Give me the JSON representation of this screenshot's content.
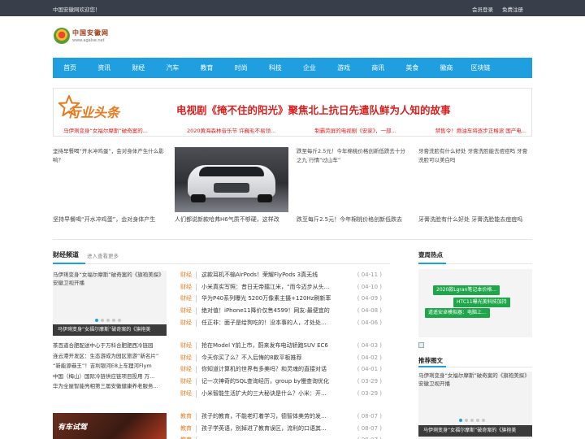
{
  "topbar": {
    "welcome": "中国安徽网欢迎您！",
    "login": "会员登录",
    "register": "免费注册"
  },
  "logo": {
    "name": "中国安徽网",
    "url": "www.agalse.net"
  },
  "nav": [
    "首页",
    "资讯",
    "财经",
    "汽车",
    "教育",
    "时尚",
    "科技",
    "企业",
    "游戏",
    "商讯",
    "美食",
    "徽商",
    "区块链"
  ],
  "banner": {
    "brand": "行业头条",
    "headline": "电视剧《掩不住的阳光》聚焦北上抗日先遣队鲜为人知的故事",
    "subs": [
      "马伊琍变身“女福尔摩斯”破奇案的...",
      "2020黄海森林音乐节 许巍毛不易领...",
      "制霸荧屏的电视剧《安家》，一部...",
      "禁售令！燃油车将逐步正格滚 国产电..."
    ]
  },
  "pictures": [
    {
      "alt": "坚持早餐喝“开水冲鸡蛋”，会对身体产生什么影响？",
      "caption": "坚持早餐喝“开水冲鸡蛋”，会对身体产生"
    },
    {
      "alt": "",
      "caption": "人们都说新款哈弗H6气质不够硬，这样改"
    },
    {
      "alt": "跌至每斤2.5元！今年棉桃价格创新低跌去十分之九 行情“过山车”",
      "caption": "跌至每斤2.5元！今年棉桃价格创新低跌去"
    },
    {
      "alt": "牙膏洗脸有什么好处 牙膏洗脸能去痘痘吗 牙膏洗脸可以美白吗",
      "caption": "牙膏洗脸有什么好处 牙膏洗脸能去痘痘吗"
    }
  ],
  "finance": {
    "title": "财经频道",
    "more": "进入查看更多",
    "slide_text": "马伊琍变身“女福尔摩斯”破奇案的《旗袍美探》安徽卫视开播",
    "slide_caption": "马伊琍变身“女福尔摩斯”破奇案的《旗袍美",
    "left_list": [
      "茶百道合肥配送中心于万科合肥肥西冷链园",
      "连云港开发区：生态游成为园区旅游“新名片”",
      "“新能源巷王”！吉利银河E8上车狸河Flym",
      "中国（梅山）国际冷链供应链项目投用 万...",
      "华为全屋智能亮相第三届安徽健康养老服务..."
    ],
    "thumb_text": "有车试驾",
    "news_top": [
      {
        "cat": "财经",
        "title": "这款耳机不输AirPods！荣耀FlyPods 3真无线",
        "date": "( 04-11 )"
      },
      {
        "cat": "财经",
        "title": "小米真实写照：昔日无帝擂江米，“而今迈步从头...",
        "date": "( 04-10 )"
      },
      {
        "cat": "财经",
        "title": "华为P40系列曝光 5200万像素主摄+120Hz刷新率",
        "date": "( 04-09 )"
      },
      {
        "cat": "财经",
        "title": "绝对值！iPhone11降价仅售4599！网友:最便宜的",
        "date": "( 04-08 )"
      },
      {
        "cat": "财经",
        "title": "任正非：面子是给狗吃的！没本事的人，才处处...",
        "date": "( 04-06 )"
      }
    ],
    "news_bottom": [
      {
        "cat": "财经",
        "title": "抢在Model Y前上市，蔚来发布电动轿跑SUV EC6",
        "date": "( 04-03 )"
      },
      {
        "cat": "财经",
        "title": "今天你买了么？不入后悔的8款平板推荐",
        "date": "( 04-02 )"
      },
      {
        "cat": "财经",
        "title": "你知道计算机的世界有多美吗？和灵魂的直接对话",
        "date": "( 04-01 )"
      },
      {
        "cat": "财经",
        "title": "记一次神奇的SQL查询经历，group by慢查询优化",
        "date": "( 03-29 )"
      },
      {
        "cat": "财经",
        "title": "小米智能生活扩大的三大秘诀是什么？小米：开...",
        "date": "( 03-29 )"
      }
    ],
    "news_third": [
      {
        "cat": "教育",
        "title": "孩子的教育，不能老盯着学习，德智体美劳的发...",
        "date": "( 08-07 )"
      },
      {
        "cat": "教育",
        "title": "孩子学英语，别掉进了教育误区，流利的口语其...",
        "date": "( 08-07 )"
      },
      {
        "cat": "教育",
        "title": "",
        "date": "( 08-07 )"
      }
    ]
  },
  "hot": {
    "title": "壹周热点",
    "tags": [
      "2020款Lgran笔记本价格...",
      "HTC11曝光美科技加持",
      "道遥安卓模拟器：电脑上..."
    ]
  },
  "recommend": {
    "title": "推荐图文",
    "slide_text": "马伊琍变身“女福尔摩斯”破奇案的《旗袍美探》安徽卫视开播",
    "slide_caption": "马伊琍变身“女福尔摩斯”破奇案的《旗袍美"
  },
  "colors": {
    "topbar": "#383f4a",
    "nav": "#1f9fe0",
    "headline": "#d62121",
    "category": "#e8791d",
    "tag": "#1fa64a"
  }
}
